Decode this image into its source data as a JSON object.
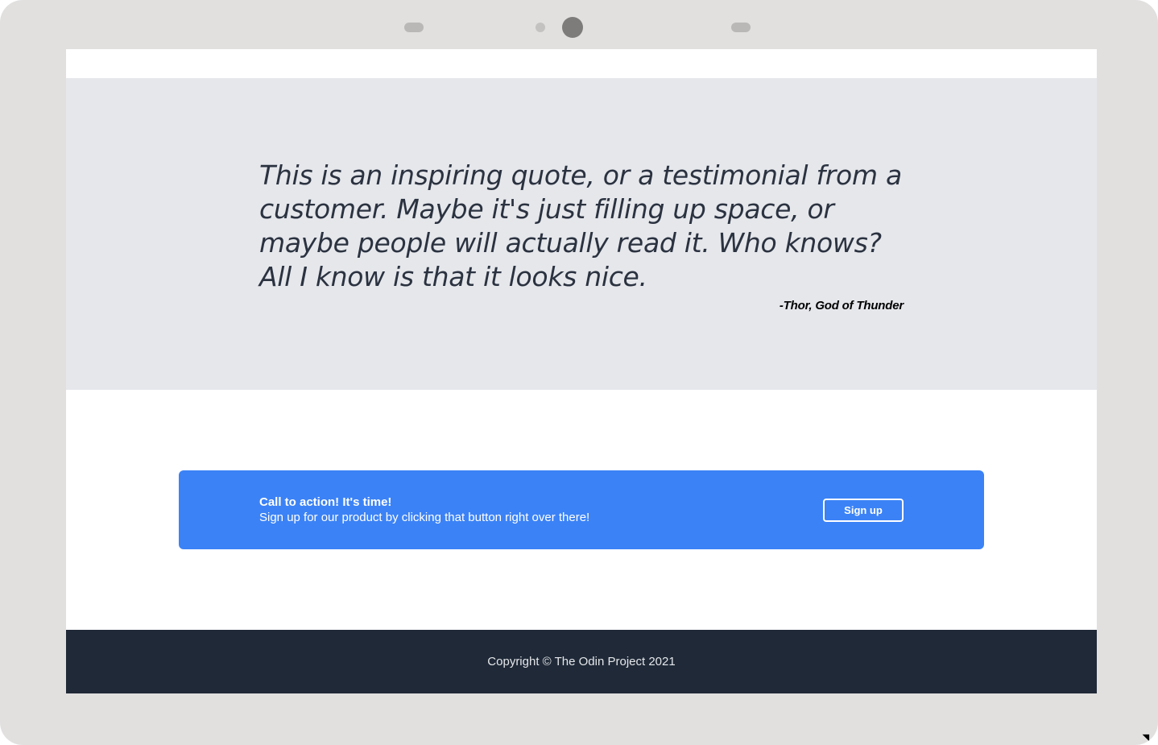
{
  "quote": {
    "text": "This is an inspiring quote, or a testimonial from a customer. Maybe it's just filling up space, or maybe people will actually read it. Who knows? All I know is that it looks nice.",
    "author": "-Thor, God of Thunder"
  },
  "cta": {
    "title": "Call to action! It's time!",
    "subtitle": "Sign up for our product by clicking that button right over there!",
    "button_label": "Sign up"
  },
  "footer": {
    "copyright": "Copyright © The Odin Project 2021"
  },
  "colors": {
    "device_frame": "#e1e0df",
    "quote_background": "#e5e7eb",
    "cta_background": "#3b82f6",
    "footer_background": "#1f2937"
  },
  "icons": {
    "camera": "camera-icon",
    "cursor": "mouse-cursor-icon"
  }
}
